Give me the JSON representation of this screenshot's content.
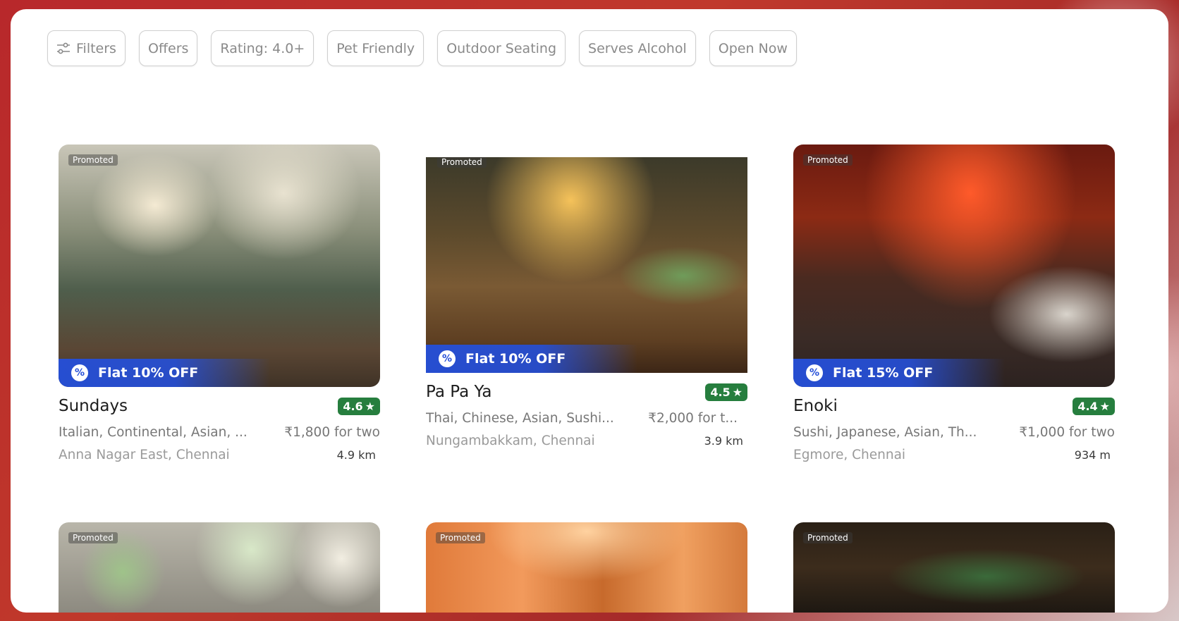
{
  "filters": [
    {
      "label": "Filters",
      "icon": "sliders-icon"
    },
    {
      "label": "Offers"
    },
    {
      "label": "Rating: 4.0+"
    },
    {
      "label": "Pet Friendly"
    },
    {
      "label": "Outdoor Seating"
    },
    {
      "label": "Serves Alcohol"
    },
    {
      "label": "Open Now"
    }
  ],
  "restaurants": [
    {
      "promoted": "Promoted",
      "offer": "Flat 10% OFF",
      "name": "Sundays",
      "rating": "4.6",
      "cuisine": "Italian, Continental, Asian, ...",
      "price": "₹1,800 for two",
      "location": "Anna Nagar East, Chennai",
      "distance": "4.9 km"
    },
    {
      "promoted": "Promoted",
      "offer": "Flat 10% OFF",
      "name": "Pa Pa Ya",
      "rating": "4.5",
      "cuisine": "Thai, Chinese, Asian, Sushi...",
      "price": "₹2,000 for t...",
      "location": "Nungambakkam, Chennai",
      "distance": "3.9 km"
    },
    {
      "promoted": "Promoted",
      "offer": "Flat 15% OFF",
      "name": "Enoki",
      "rating": "4.4",
      "cuisine": "Sushi, Japanese, Asian, Th...",
      "price": "₹1,000 for two",
      "location": "Egmore, Chennai",
      "distance": "934 m"
    }
  ],
  "bottom_row": [
    {
      "promoted": "Promoted"
    },
    {
      "promoted": "Promoted"
    },
    {
      "promoted": "Promoted"
    }
  ],
  "colors": {
    "rating_green": "#267e3e",
    "offer_blue": "#254fd8",
    "frame_red": "#c0392b"
  }
}
